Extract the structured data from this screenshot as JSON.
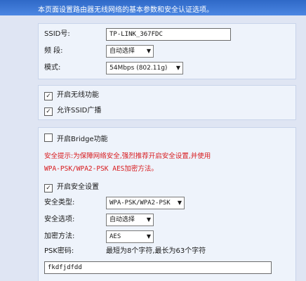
{
  "intro": "本页面设置路由器无线网络的基本参数和安全认证选项。",
  "basic": {
    "ssid_label": "SSID号:",
    "ssid_value": "TP-LINK_367FDC",
    "channel_label": "频 段:",
    "channel_value": "自动选择",
    "mode_label": "模式:",
    "mode_value": "54Mbps (802.11g)"
  },
  "toggles": {
    "enable_wireless": "开启无线功能",
    "allow_ssid_broadcast": "允许SSID广播"
  },
  "security": {
    "bridge_label": "开启Bridge功能",
    "warning_line1": "安全提示:为保障网络安全,强烈推荐开启安全设置,并使用",
    "warning_line2": "WPA-PSK/WPA2-PSK AES加密方法。",
    "enable_security": "开启安全设置",
    "type_label": "安全类型:",
    "type_value": "WPA-PSK/WPA2-PSK",
    "option_label": "安全选项:",
    "option_value": "自动选择",
    "encryption_label": "加密方法:",
    "encryption_value": "AES",
    "psk_label": "PSK密码:",
    "psk_hint": "最短为8个字符,最长为63个字符",
    "psk_value": "fkdfjdfdd"
  },
  "checks": {
    "enable_wireless": true,
    "ssid_broadcast": true,
    "bridge": false,
    "security": true
  }
}
